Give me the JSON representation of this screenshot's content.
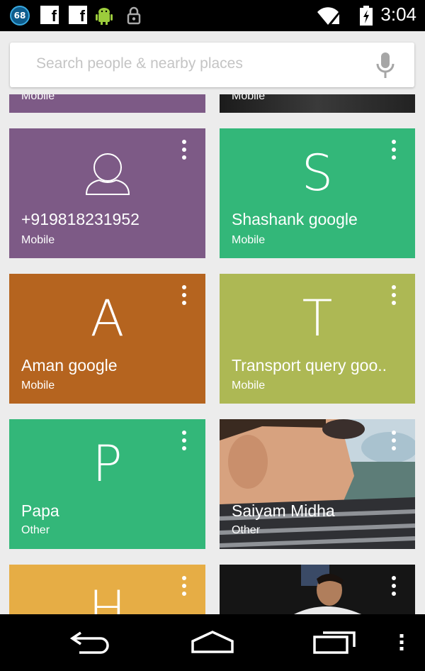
{
  "status_bar": {
    "notification_count": "68",
    "time": "3:04",
    "icons": [
      "notification-count-icon",
      "facebook-icon",
      "facebook-icon",
      "android-icon",
      "lock-icon",
      "wifi-icon",
      "signal-icon",
      "battery-charging-icon"
    ]
  },
  "search": {
    "placeholder": "Search people & nearby places",
    "mic_icon": "microphone-icon"
  },
  "contacts": [
    {
      "name": "",
      "type": "Mobile",
      "color": "#7d5a86"
    },
    {
      "name": "",
      "type": "Mobile",
      "color": "#2b2b2b"
    },
    {
      "name": "+919818231952",
      "type": "Mobile",
      "color": "#7d5a86",
      "avatar": "person-icon"
    },
    {
      "name": "Shashank google",
      "type": "Mobile",
      "color": "#33b779",
      "initial": "S"
    },
    {
      "name": "Aman google",
      "type": "Mobile",
      "color": "#b5641f",
      "initial": "A"
    },
    {
      "name": "Transport query goo..",
      "type": "Mobile",
      "color": "#adb854",
      "initial": "T"
    },
    {
      "name": "Papa",
      "type": "Other",
      "color": "#33b779",
      "initial": "P"
    },
    {
      "name": "Saiyam Midha",
      "type": "Other",
      "color": "#6a7a70",
      "photo": true
    },
    {
      "name": "",
      "type": "",
      "color": "#e6ad45",
      "initial": "H"
    },
    {
      "name": "",
      "type": "",
      "color": "#1e1e1e",
      "photo": true
    }
  ],
  "nav_bar": {
    "buttons": [
      "back-button",
      "home-button",
      "recents-button",
      "menu-button"
    ]
  }
}
